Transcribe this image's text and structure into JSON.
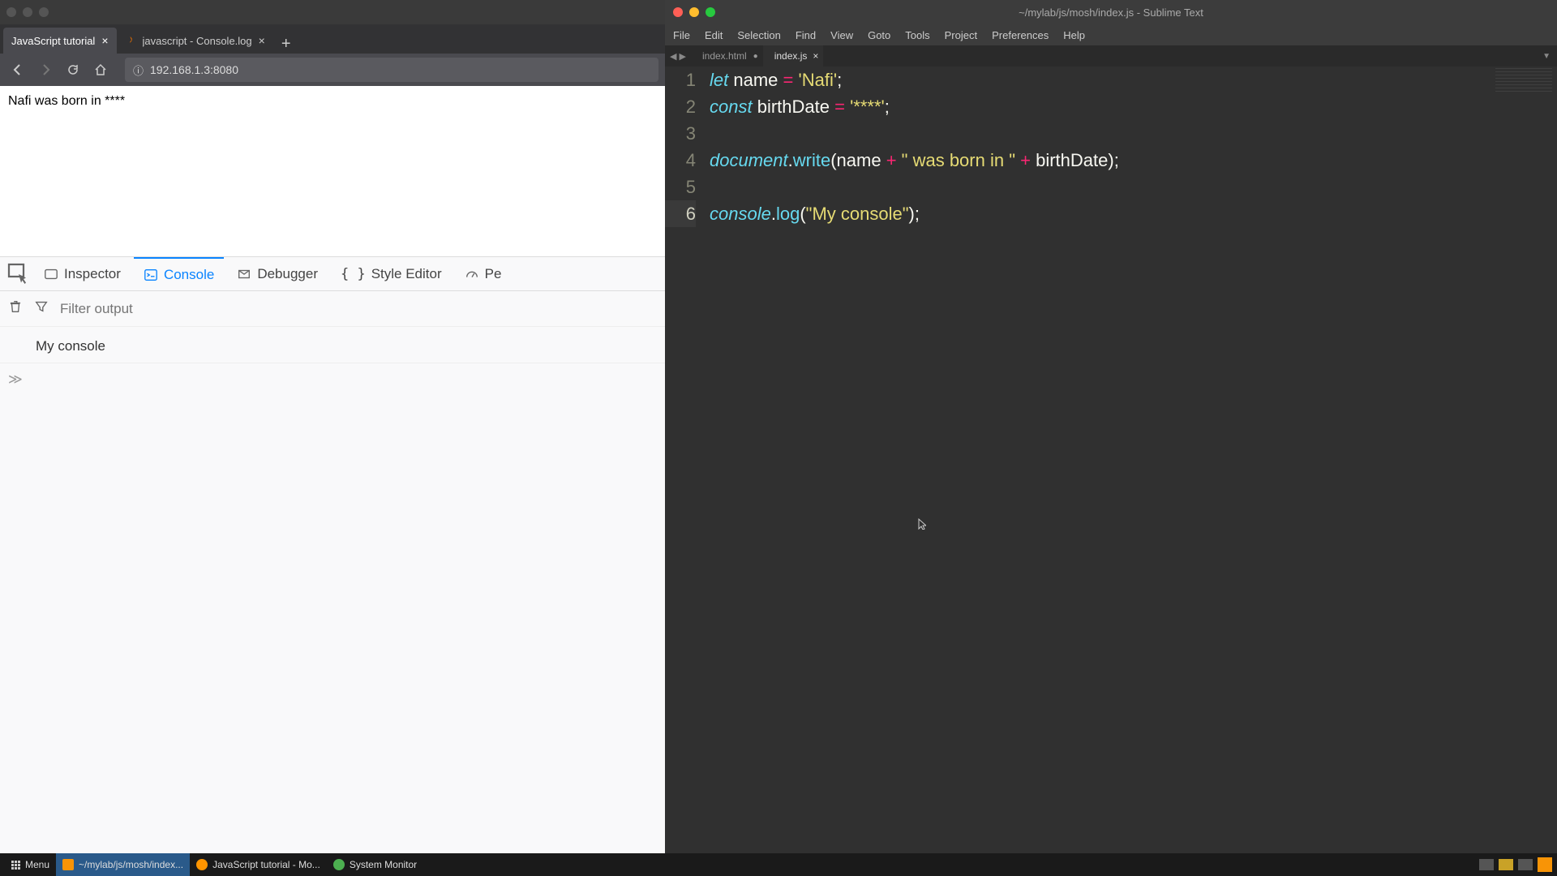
{
  "browser": {
    "tabs": [
      {
        "title": "JavaScript tutorial",
        "active": true
      },
      {
        "title": "javascript - Console.log",
        "active": false
      }
    ],
    "address": "192.168.1.3:8080",
    "page_text": "Nafi was born in ****"
  },
  "devtools": {
    "tabs": {
      "inspector": "Inspector",
      "console": "Console",
      "debugger": "Debugger",
      "style_editor": "Style Editor",
      "performance": "Pe"
    },
    "filter_placeholder": "Filter output",
    "console_output": "My console",
    "prompt": "≫"
  },
  "sublime": {
    "title": "~/mylab/js/mosh/index.js - Sublime Text",
    "menu": [
      "File",
      "Edit",
      "Selection",
      "Find",
      "View",
      "Goto",
      "Tools",
      "Project",
      "Preferences",
      "Help"
    ],
    "tabs": [
      {
        "name": "index.html",
        "active": false,
        "dirty": true
      },
      {
        "name": "index.js",
        "active": true,
        "dirty": false
      }
    ],
    "code": {
      "l1": {
        "kw": "let",
        "var": "name",
        "op": "=",
        "str": "'Nafi'",
        "end": ";"
      },
      "l2": {
        "kw": "const",
        "var": "birthDate",
        "op": "=",
        "str": "'****'",
        "end": ";"
      },
      "l4": {
        "obj": "document",
        "dot": ".",
        "method": "write",
        "open": "(",
        "a1": "name",
        "p1": " + ",
        "s1": "\" was born in \"",
        "p2": " + ",
        "a2": "birthDate",
        "close": ");"
      },
      "l6": {
        "obj": "console",
        "dot": ".",
        "method": "log",
        "open": "(",
        "str": "\"My console\"",
        "close": ");"
      }
    },
    "line_numbers": [
      "1",
      "2",
      "3",
      "4",
      "5",
      "6"
    ]
  },
  "taskbar": {
    "menu": "Menu",
    "items": [
      {
        "label": "~/mylab/js/mosh/index...",
        "active": true
      },
      {
        "label": "JavaScript tutorial - Mo...",
        "active": false
      },
      {
        "label": "System Monitor",
        "active": false
      }
    ]
  }
}
